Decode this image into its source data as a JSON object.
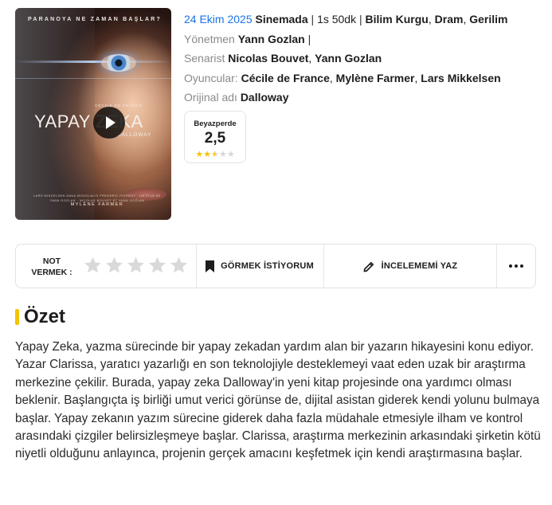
{
  "poster": {
    "tagline": "PARANOYA NE ZAMAN BAŞLAR?",
    "title": "YAPAY ZEKA",
    "subtitle": "DALLOWAY",
    "top_cast": "CÉCILE DE FRANCE",
    "featured": "MYLÈNE FARMER",
    "credits": "LARS MIKKELSEN  ANNA MOUGLALIS  FREDERIC PIERROT · UN FILM DE YANN GOZLAN · NICOLAS BOUVET ET YANN GOZLAN"
  },
  "info": {
    "release_date": "24 Ekim 2025",
    "release_status": "Sinemada",
    "duration": "1s 50dk",
    "genres": [
      "Bilim Kurgu",
      "Dram",
      "Gerilim"
    ],
    "director_label": "Yönetmen",
    "director": "Yann Gozlan",
    "writer_label": "Senarist",
    "writers": [
      "Nicolas Bouvet",
      "Yann Gozlan"
    ],
    "cast_label": "Oyuncular:",
    "cast": [
      "Cécile de France",
      "Mylène Farmer",
      "Lars Mikkelsen"
    ],
    "original_title_label": "Orijinal adı",
    "original_title": "Dalloway"
  },
  "rating": {
    "source": "Beyazperde",
    "score": "2,5",
    "stars_value": 2.5,
    "stars_max": 5
  },
  "actions": {
    "rate_label_line1": "NOT",
    "rate_label_line2": "VERMEK :",
    "watchlist_label": "GÖRMEK İSTİYORUM",
    "review_label": "İNCELEMEMİ YAZ"
  },
  "summary": {
    "heading": "Özet",
    "text": "Yapay Zeka, yazma sürecinde bir yapay zekadan yardım alan bir yazarın hikayesini konu ediyor. Yazar Clarissa, yaratıcı yazarlığı en son teknolojiyle desteklemeyi vaat eden uzak bir araştırma merkezine çekilir. Burada, yapay zeka Dalloway'in yeni kitap projesinde ona yardımcı olması beklenir. Başlangıçta iş birliği umut verici görünse de, dijital asistan giderek kendi yolunu bulmaya başlar. Yapay zekanın yazım sürecine giderek daha fazla müdahale etmesiyle ilham ve kontrol arasındaki çizgiler belirsizleşmeye başlar. Clarissa, araştırma merkezinin arkasındaki şirketin kötü niyetli olduğunu anlayınca, projenin gerçek amacını keşfetmek için kendi araştırmasına başlar."
  },
  "colors": {
    "accent_blue": "#1a73e8",
    "star_yellow": "#f1c40f",
    "heading_bar": "#f4c400"
  }
}
